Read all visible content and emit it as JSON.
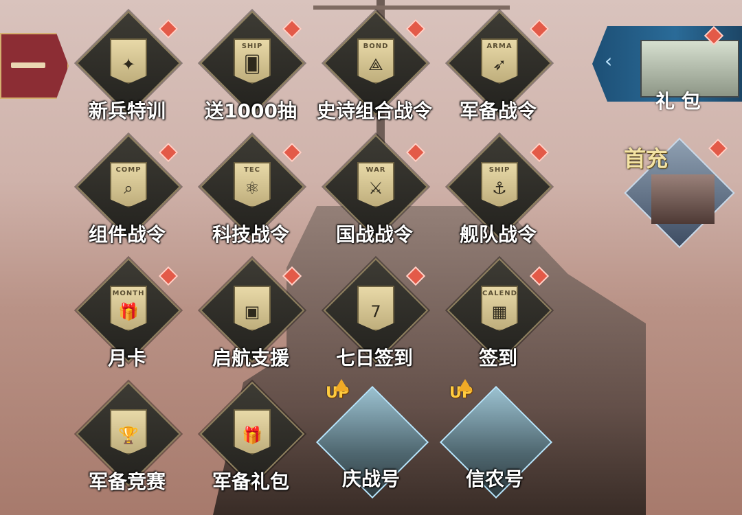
{
  "ui": {
    "top_left_button_label": "",
    "gift_label": "礼 包",
    "firstpay_label": "首充",
    "items": [
      {
        "label": "新兵特训",
        "badge": "",
        "icon": "eagle-icon"
      },
      {
        "label": "送1000抽",
        "badge": "SHIP",
        "icon": "cards-icon"
      },
      {
        "label": "史诗组合战令",
        "badge": "BOND",
        "icon": "triangle-knot-icon"
      },
      {
        "label": "军备战令",
        "badge": "ARMA",
        "icon": "missile-icon"
      },
      {
        "label": "组件战令",
        "badge": "COMP",
        "icon": "component-icon"
      },
      {
        "label": "科技战令",
        "badge": "TEC",
        "icon": "atom-icon"
      },
      {
        "label": "国战战令",
        "badge": "WAR",
        "icon": "crossed-swords-icon"
      },
      {
        "label": "舰队战令",
        "badge": "SHIP",
        "icon": "anchor-icon"
      },
      {
        "label": "月卡",
        "badge": "MONTH",
        "icon": "gift-card-icon"
      },
      {
        "label": "启航支援",
        "badge": "",
        "icon": "supply-box-icon"
      },
      {
        "label": "七日签到",
        "badge": "7",
        "icon": "seven-day-icon"
      },
      {
        "label": "签到",
        "badge": "CALENDAR",
        "icon": "calendar-icon"
      },
      {
        "label": "军备竞赛",
        "badge": "",
        "icon": "trophy-icon"
      },
      {
        "label": "军备礼包",
        "badge": "",
        "icon": "gift-trophy-icon"
      },
      {
        "label": "庆战号",
        "badge": "UP",
        "icon": "ship-card-icon"
      },
      {
        "label": "信农号",
        "badge": "UP",
        "icon": "carrier-card-icon"
      }
    ]
  }
}
